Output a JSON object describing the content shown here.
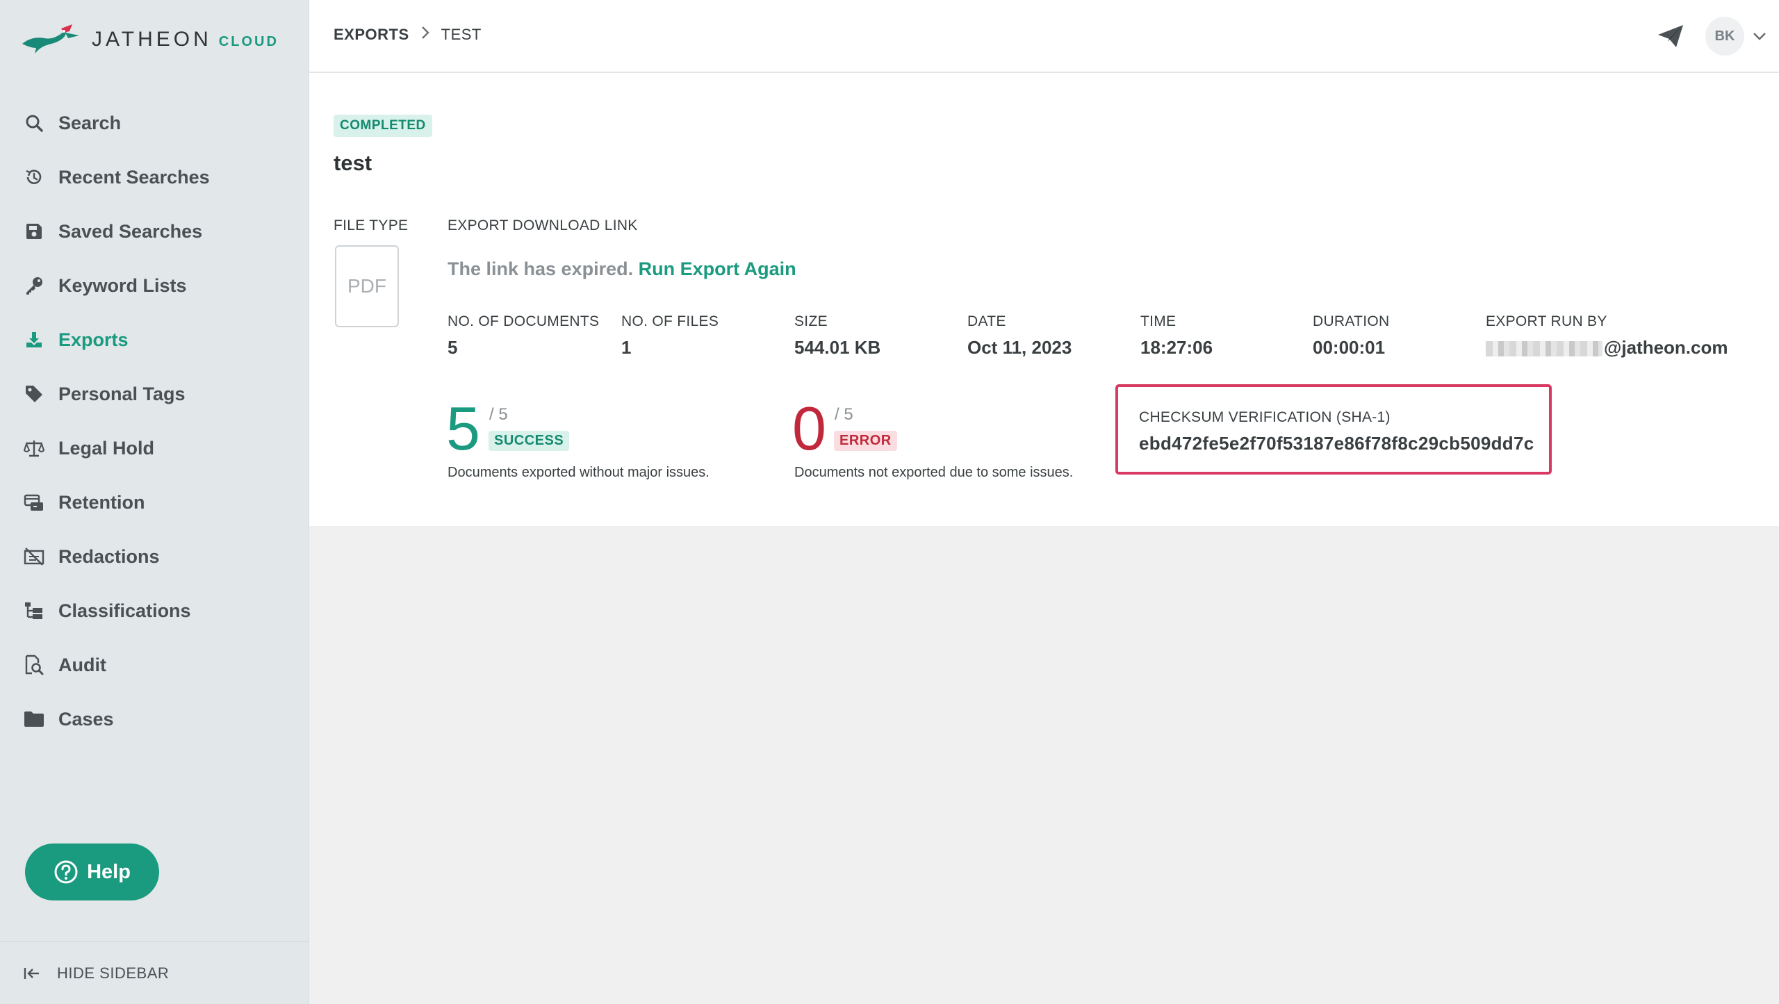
{
  "brand": {
    "name": "JATHEON",
    "suffix": "CLOUD"
  },
  "sidebar": {
    "items": [
      {
        "label": "Search",
        "icon": "search-icon"
      },
      {
        "label": "Recent Searches",
        "icon": "history-icon"
      },
      {
        "label": "Saved Searches",
        "icon": "floppy-disk-icon"
      },
      {
        "label": "Keyword Lists",
        "icon": "key-icon"
      },
      {
        "label": "Exports",
        "icon": "download-icon",
        "active": true
      },
      {
        "label": "Personal Tags",
        "icon": "tag-icon"
      },
      {
        "label": "Legal Hold",
        "icon": "scales-icon"
      },
      {
        "label": "Retention",
        "icon": "retention-icon"
      },
      {
        "label": "Redactions",
        "icon": "redaction-icon"
      },
      {
        "label": "Classifications",
        "icon": "classification-icon"
      },
      {
        "label": "Audit",
        "icon": "audit-icon"
      },
      {
        "label": "Cases",
        "icon": "folder-icon"
      }
    ],
    "help_label": "Help",
    "hide_label": "HIDE SIDEBAR"
  },
  "header": {
    "breadcrumb": [
      "EXPORTS",
      "TEST"
    ],
    "avatar_initials": "BK"
  },
  "export": {
    "status": "COMPLETED",
    "title": "test",
    "file_type_label": "FILE TYPE",
    "file_type": "PDF",
    "download_link_label": "EXPORT DOWNLOAD LINK",
    "expired_text": "The link has expired.",
    "run_again_label": "Run Export Again",
    "stats": {
      "documents_label": "NO. OF DOCUMENTS",
      "documents": "5",
      "files_label": "NO. OF FILES",
      "files": "1",
      "size_label": "SIZE",
      "size": "544.01 KB",
      "date_label": "DATE",
      "date": "Oct 11, 2023",
      "time_label": "TIME",
      "time": "18:27:06",
      "duration_label": "DURATION",
      "duration": "00:00:01",
      "run_by_label": "EXPORT RUN BY",
      "run_by_domain": "@jatheon.com"
    },
    "success": {
      "count": "5",
      "total": "/ 5",
      "badge": "SUCCESS",
      "description": "Documents exported without major issues."
    },
    "error": {
      "count": "0",
      "total": "/ 5",
      "badge": "ERROR",
      "description": "Documents not exported due to some issues."
    },
    "checksum": {
      "label": "CHECKSUM VERIFICATION (SHA-1)",
      "value": "ebd472fe5e2f70f53187e86f78f8c29cb509dd7c"
    }
  },
  "colors": {
    "accent": "#1a9a7f",
    "error": "#c2283b",
    "highlight": "#d93a63",
    "sidebar_bg": "#e2e7ea"
  }
}
